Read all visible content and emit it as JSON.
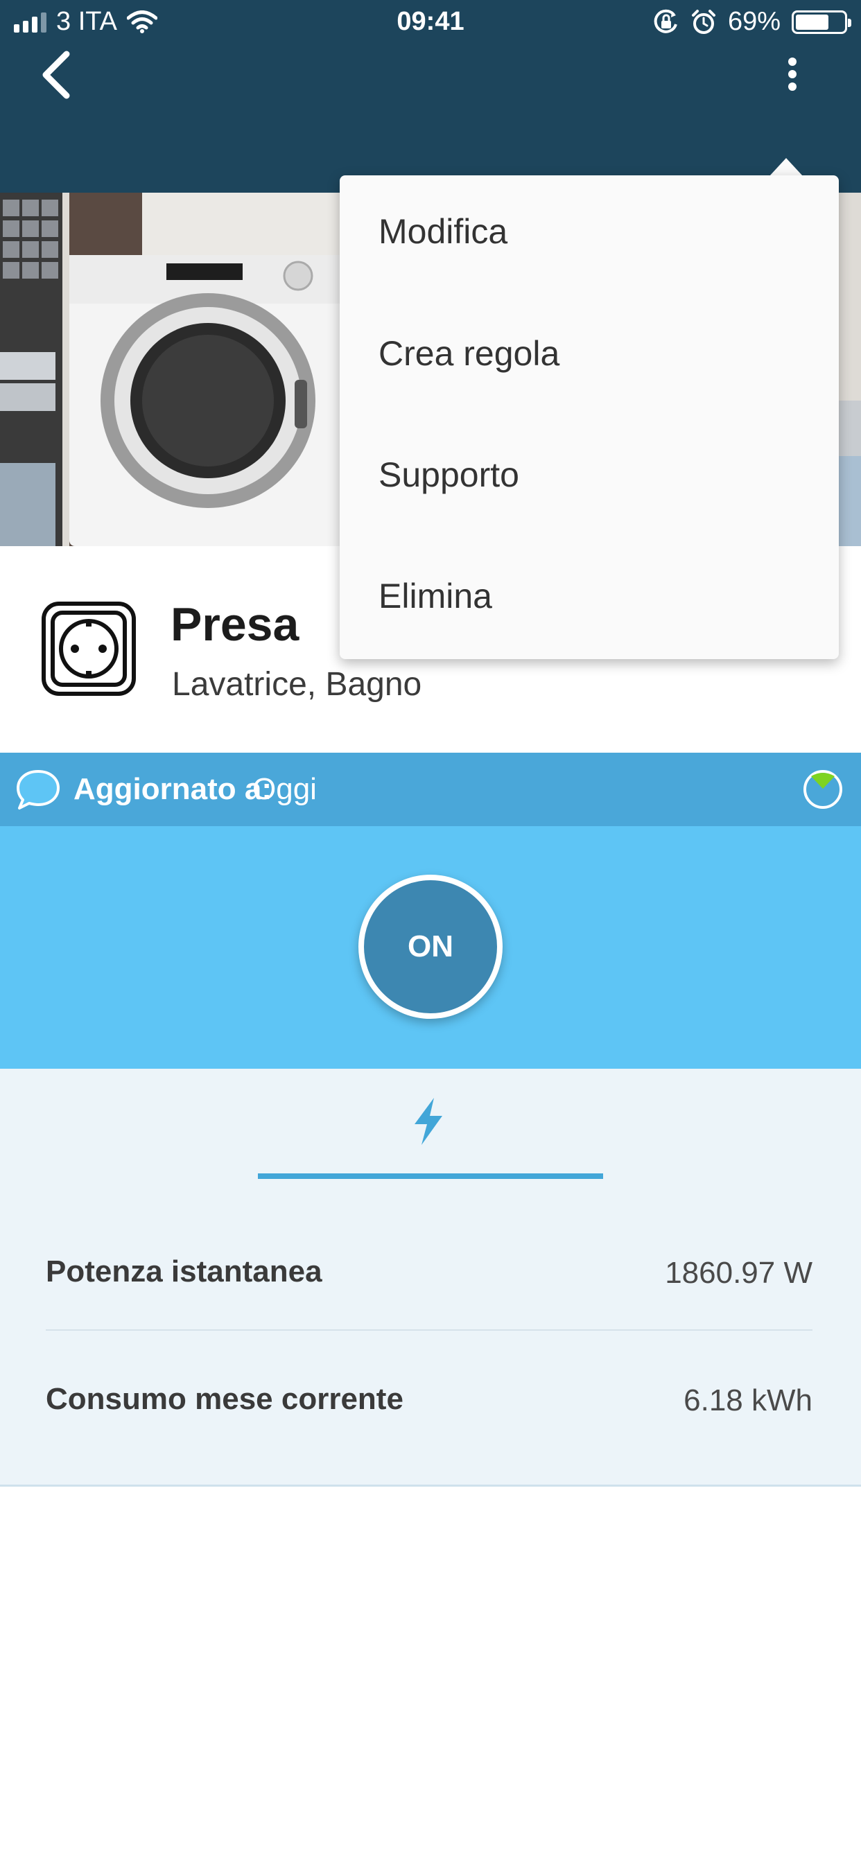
{
  "status_bar": {
    "carrier": "3 ITA",
    "time": "09:41",
    "battery_percent": "69%",
    "battery_level": 0.69
  },
  "device": {
    "title": "Presa",
    "subtitle": "Lavatrice, Bagno"
  },
  "updated": {
    "label": "Aggiornato a:",
    "value": "Oggi"
  },
  "control": {
    "toggle_label": "ON"
  },
  "stats": {
    "rows": [
      {
        "label": "Potenza istantanea",
        "value": "1860.97 W"
      },
      {
        "label": "Consumo mese corrente",
        "value": "6.18 kWh"
      }
    ]
  },
  "menu": {
    "items": [
      {
        "label": "Modifica"
      },
      {
        "label": "Crea regola"
      },
      {
        "label": "Supporto"
      },
      {
        "label": "Elimina"
      }
    ]
  },
  "colors": {
    "appbar": "#1d455c",
    "updated_bar": "#4aa7d9",
    "control_bg": "#5ec5f5",
    "toggle": "#3d87b1",
    "stats_bg": "#ecf4f9",
    "accent": "#42a6d8",
    "online_dot": "#7ed321"
  }
}
